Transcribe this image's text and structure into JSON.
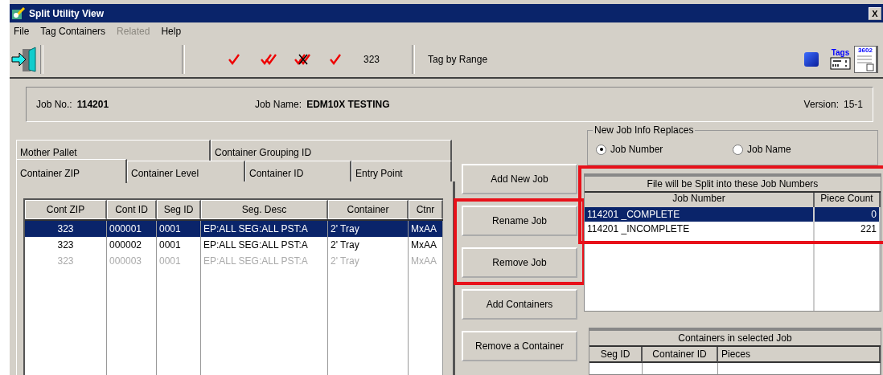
{
  "window": {
    "title": "Split Utility View",
    "close": "X"
  },
  "menu": [
    {
      "label": "File",
      "disabled": false
    },
    {
      "label": "Tag Containers",
      "disabled": false
    },
    {
      "label": "Related",
      "disabled": true
    },
    {
      "label": "Help",
      "disabled": false
    }
  ],
  "toolbar": {
    "tools": [
      {
        "kind": "check"
      },
      {
        "kind": "double-check"
      },
      {
        "kind": "cross-check"
      },
      {
        "kind": "check"
      }
    ],
    "count": "323",
    "tag_by_range": "Tag by Range",
    "tags_label": "Tags",
    "form_label": "3602"
  },
  "job_info": {
    "job_no_label": "Job No.:",
    "job_no": "114201",
    "job_name_label": "Job Name:",
    "job_name": "EDM10X TESTING",
    "version_label": "Version:",
    "version": "15-1"
  },
  "tabs": [
    [
      {
        "label": "Mother Pallet",
        "selected": false
      },
      {
        "label": "Container Grouping ID",
        "selected": false
      }
    ],
    [
      {
        "label": "Container ZIP",
        "selected": true
      },
      {
        "label": "Container Level",
        "selected": false
      },
      {
        "label": "Container ID",
        "selected": false
      },
      {
        "label": "Entry Point",
        "selected": false
      }
    ]
  ],
  "containers_table": {
    "columns": [
      "Cont ZIP",
      "Cont ID",
      "Seg ID",
      "Seg. Desc",
      "Container",
      "Ctnr"
    ],
    "rows": [
      {
        "cells": [
          "323",
          "000001",
          "0001",
          "EP:ALL SEG:ALL PST:A",
          "2' Tray",
          "MxAA"
        ],
        "selected": true,
        "disabled": false
      },
      {
        "cells": [
          "323",
          "000002",
          "0001",
          "EP:ALL SEG:ALL PST:A",
          "2' Tray",
          "MxAA"
        ],
        "selected": false,
        "disabled": false
      },
      {
        "cells": [
          "323",
          "000003",
          "0001",
          "EP:ALL SEG:ALL PST:A",
          "2' Tray",
          "MxAA"
        ],
        "selected": false,
        "disabled": true
      }
    ]
  },
  "buttons": [
    {
      "label": "Add New Job",
      "highlighted": false
    },
    {
      "label": "Rename Job",
      "highlighted": true
    },
    {
      "label": "Remove Job",
      "highlighted": true
    },
    {
      "label": "Add Containers",
      "highlighted": false
    },
    {
      "label": "Remove a Container",
      "highlighted": false
    }
  ],
  "replaces": {
    "title": "New Job Info Replaces",
    "options": [
      {
        "label": "Job Number",
        "selected": true
      },
      {
        "label": "Job Name",
        "selected": false
      }
    ]
  },
  "jobs_table": {
    "caption": "File will be Split into these Job Numbers",
    "highlighted": true,
    "columns": [
      "Job Number",
      "Piece Count"
    ],
    "rows": [
      {
        "job": "114201 _COMPLETE",
        "count": "0",
        "selected": true
      },
      {
        "job": "114201 _INCOMPLETE",
        "count": "221",
        "selected": false
      }
    ]
  },
  "selected_job_table": {
    "caption": "Containers in selected Job",
    "columns": [
      "Seg ID",
      "Container ID",
      "Pieces"
    ]
  }
}
